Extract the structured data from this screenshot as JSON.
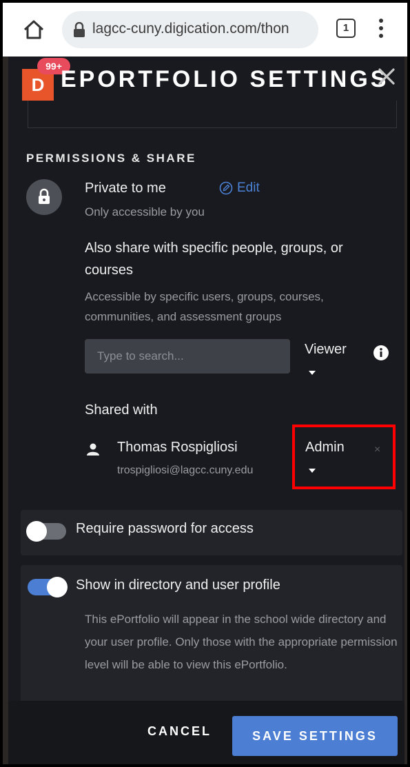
{
  "browser": {
    "url": "lagcc-cuny.digication.com/thon",
    "tab_count": "1",
    "icons": [
      "home-icon",
      "lock-icon",
      "tab-switcher-icon",
      "more-vert-icon"
    ]
  },
  "modal": {
    "title": "EPORTFOLIO SETTINGS",
    "logo_letter": "D",
    "notification_badge": "99+",
    "close_icon": "close-icon",
    "permissions": {
      "heading": "PERMISSIONS & SHARE",
      "private_label": "Private to me",
      "edit_label": "Edit",
      "private_subtitle": "Only accessible by you",
      "share_label": "Also share with specific people, groups, or courses",
      "share_subtitle": "Accessible by specific users, groups, courses, communities, and assessment groups",
      "search_placeholder": "Type to search...",
      "role_select_value": "Viewer",
      "shared_with_label": "Shared with",
      "shared_users": [
        {
          "name": "Thomas Rospigliosi",
          "email": "trospigliosi@lagcc.cuny.edu",
          "role": "Admin",
          "remove_label": "×"
        }
      ]
    },
    "require_password": {
      "label": "Require password for access",
      "enabled": false
    },
    "show_in_directory": {
      "label": "Show in directory and user profile",
      "enabled": true,
      "description": "This ePortfolio will appear in the school wide directory and your user profile. Only those with the appropriate permission level will be able to view this ePortfolio."
    },
    "footer": {
      "cancel_label": "CANCEL",
      "save_label": "SAVE SETTINGS"
    }
  },
  "colors": {
    "accent": "#4c7fd4",
    "logo": "#e8552b",
    "badge": "#e84c5c",
    "highlight": "#ff0000",
    "modal_bg": "#1b1d22"
  }
}
